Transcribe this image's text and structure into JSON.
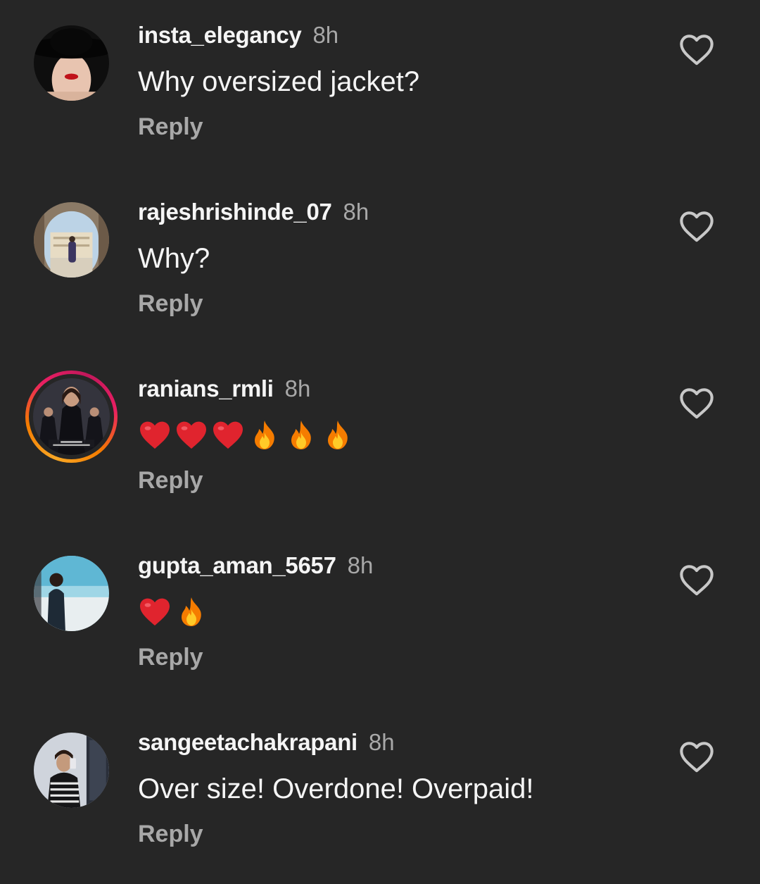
{
  "comments": [
    {
      "username": "insta_elegancy",
      "time": "8h",
      "text": "Why oversized jacket?",
      "reply_label": "Reply",
      "avatar_icon": "avatar-woman-hat",
      "has_story_ring": false
    },
    {
      "username": "rajeshrishinde_07",
      "time": "8h",
      "text": "Why?",
      "reply_label": "Reply",
      "avatar_icon": "avatar-palace-photo",
      "has_story_ring": false
    },
    {
      "username": "ranians_rmli",
      "time": "8h",
      "text": "❤️❤️❤️🔥🔥🔥",
      "reply_label": "Reply",
      "avatar_icon": "avatar-rmli-poster",
      "has_story_ring": true,
      "emojis": [
        "heart",
        "heart",
        "heart",
        "fire",
        "fire",
        "fire"
      ]
    },
    {
      "username": "gupta_aman_5657",
      "time": "8h",
      "text": "❤️🔥",
      "reply_label": "Reply",
      "avatar_icon": "avatar-beach-photo",
      "has_story_ring": false,
      "emojis": [
        "heart",
        "fire"
      ]
    },
    {
      "username": "sangeetachakrapani",
      "time": "8h",
      "text": "Over size! Overdone! Overpaid!",
      "reply_label": "Reply",
      "avatar_icon": "avatar-mirror-selfie",
      "has_story_ring": false
    }
  ],
  "like_icon": "heart-outline-icon",
  "colors": {
    "background": "#262626",
    "primary_text": "#f5f5f5",
    "secondary_text": "#a8a8a8",
    "story_ring": [
      "#f9a825",
      "#e91e63"
    ]
  }
}
